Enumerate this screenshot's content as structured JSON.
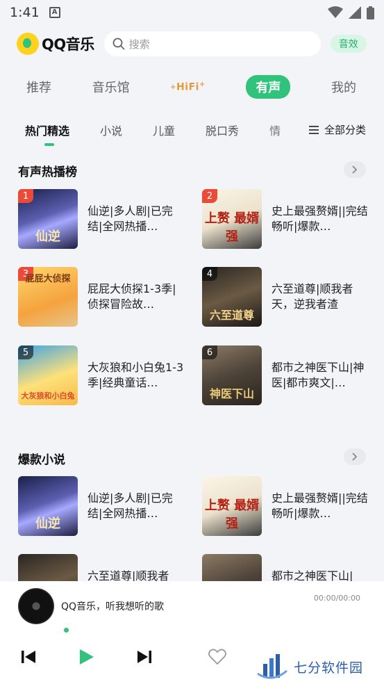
{
  "status": {
    "time": "1:41"
  },
  "header": {
    "logo_text": "QQ音乐",
    "search_placeholder": "搜索",
    "effect_label": "音效"
  },
  "top_tabs": [
    "推荐",
    "音乐馆",
    "HiFi",
    "有声",
    "我的"
  ],
  "sub_tabs": [
    "热门精选",
    "小说",
    "儿童",
    "脱口秀",
    "情"
  ],
  "all_categories": "全部分类",
  "hot_section": {
    "title": "有声热播榜",
    "items": [
      {
        "rank": "1",
        "title": "仙逆|多人剧|已完结|全网热播…",
        "cover_text": "仙逆"
      },
      {
        "rank": "2",
        "title": "史上最强赘婿||完结畅听|爆款…",
        "cover_text": "上赘 最婿 强"
      },
      {
        "rank": "3",
        "title": "屁屁大侦探1-3季|侦探冒险故…",
        "cover_text": "屁屁大侦探"
      },
      {
        "rank": "4",
        "title": "六至道尊|顺我者天，逆我者渣",
        "cover_text": "六至道尊"
      },
      {
        "rank": "5",
        "title": "大灰狼和小白兔1-3季|经典童话…",
        "cover_text": "大灰狼和小白兔"
      },
      {
        "rank": "6",
        "title": "都市之神医下山|神医|都市爽文|…",
        "cover_text": "神医下山"
      }
    ]
  },
  "novel_section": {
    "title": "爆款小说",
    "items": [
      {
        "title": "仙逆|多人剧|已完结|全网热播…",
        "cover_text": "仙逆"
      },
      {
        "title": "史上最强赘婿||完结畅听|爆款…",
        "cover_text": "上赘 最婿 强"
      },
      {
        "title": "六至道尊|顺我者",
        "cover_text": ""
      },
      {
        "title": "都市之神医下山|",
        "cover_text": ""
      }
    ]
  },
  "player": {
    "song": "QQ音乐，听我想听的歌",
    "time": "00:00/00:00"
  },
  "watermark": {
    "text": "七分软件园"
  },
  "colors": {
    "accent": "#31c27c",
    "rank_red": "#ea4a37",
    "background": "#f3f4f8"
  }
}
